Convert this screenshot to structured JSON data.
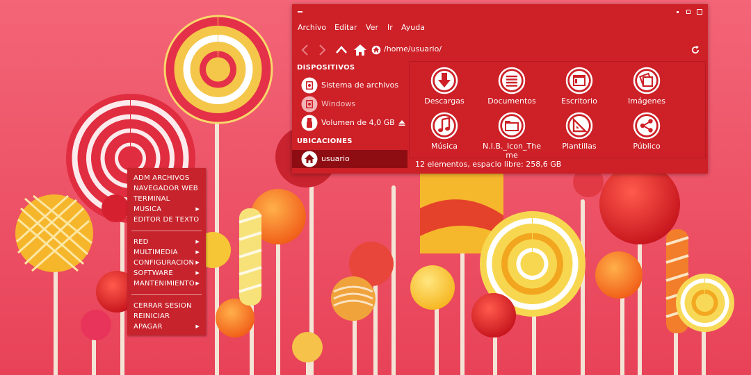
{
  "desktop": {
    "background_color": "#ee4f62"
  },
  "context_menu": {
    "groups": [
      [
        {
          "label": "ADM ARCHIVOS",
          "submenu": false
        },
        {
          "label": "NAVEGADOR WEB",
          "submenu": false
        },
        {
          "label": "TERMINAL",
          "submenu": false
        },
        {
          "label": "MUSICA",
          "submenu": true
        },
        {
          "label": "EDITOR DE TEXTO",
          "submenu": false
        }
      ],
      [
        {
          "label": "RED",
          "submenu": true
        },
        {
          "label": "MULTIMEDIA",
          "submenu": true
        },
        {
          "label": "CONFIGURACION",
          "submenu": true
        },
        {
          "label": "SOFTWARE",
          "submenu": true
        },
        {
          "label": "MANTENIMIENTO",
          "submenu": true
        }
      ],
      [
        {
          "label": "CERRAR SESION",
          "submenu": false
        },
        {
          "label": "REINICIAR",
          "submenu": false
        },
        {
          "label": "APAGAR",
          "submenu": true
        }
      ]
    ]
  },
  "file_manager": {
    "accent": "#cd2027",
    "selected_color": "#8e0d13",
    "menubar": [
      "Archivo",
      "Editar",
      "Ver",
      "Ir",
      "Ayuda"
    ],
    "path": "/home/usuario/",
    "sidebar": {
      "devices_heading": "DISPOSITIVOS",
      "devices": [
        {
          "label": "Sistema de archivos",
          "icon": "drive-icon"
        },
        {
          "label": "Windows",
          "icon": "drive-icon"
        },
        {
          "label": "Volumen de 4,0 GB",
          "icon": "usb-icon"
        }
      ],
      "places_heading": "UBICACIONES",
      "places": [
        {
          "label": "usuario",
          "icon": "home-icon",
          "selected": true
        }
      ]
    },
    "items": [
      {
        "label": "Descargas",
        "icon": "download-icon"
      },
      {
        "label": "Documentos",
        "icon": "document-icon"
      },
      {
        "label": "Escritorio",
        "icon": "desktop-icon"
      },
      {
        "label": "Imágenes",
        "icon": "images-icon"
      },
      {
        "label": "Música",
        "icon": "music-icon"
      },
      {
        "label": "N.I.B._Icon_The\nme",
        "icon": "folder-icon"
      },
      {
        "label": "Plantillas",
        "icon": "templates-icon"
      },
      {
        "label": "Público",
        "icon": "share-icon"
      }
    ],
    "status": "12 elementos, espacio libre: 258,6 GB"
  }
}
